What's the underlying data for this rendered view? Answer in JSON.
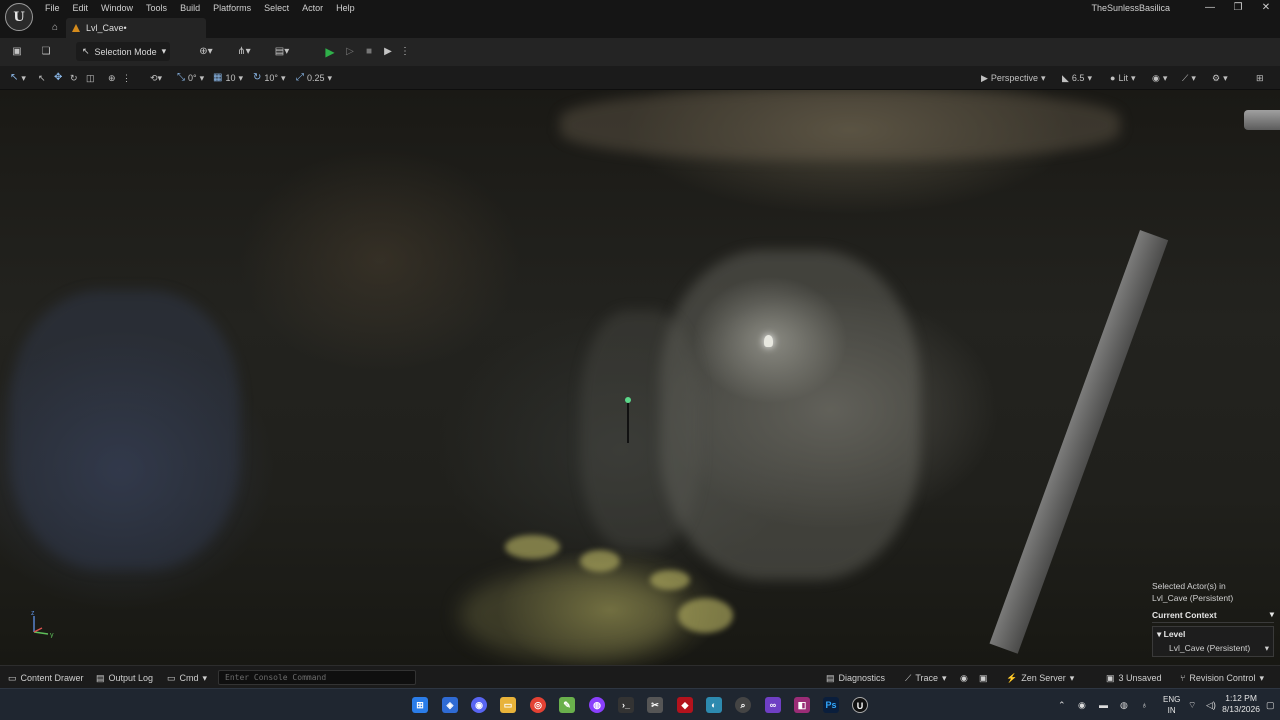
{
  "menubar": {
    "logo": "U",
    "items": [
      "File",
      "Edit",
      "Window",
      "Tools",
      "Build",
      "Platforms",
      "Select",
      "Actor",
      "Help"
    ],
    "project_name": "TheSunlessBasilica",
    "window_controls": {
      "minimize": "—",
      "restore": "❐",
      "close": "✕"
    }
  },
  "tabs": {
    "home_icon": "⌂",
    "level_tab": "Lvl_Cave•"
  },
  "toolbar": {
    "selection_mode": "Selection Mode"
  },
  "viewport_toolbar": {
    "grid_rotation": "0°",
    "grid_snap": "10",
    "rotation_snap": "10°",
    "scale_snap": "0.25",
    "view_mode": "Perspective",
    "camera_speed": "6.5",
    "lighting": "Lit"
  },
  "context": {
    "selected_line1": "Selected Actor(s) in",
    "selected_line2": "Lvl_Cave (Persistent)",
    "header": "Current Context",
    "level_title": "Level",
    "level_value": "Lvl_Cave (Persistent)"
  },
  "statusbar": {
    "content_drawer": "Content Drawer",
    "output_log": "Output Log",
    "cmd": "Cmd",
    "console_placeholder": "Enter Console Command",
    "diagnostics": "Diagnostics",
    "trace": "Trace",
    "zen_server": "Zen Server",
    "unsaved": "3 Unsaved",
    "revision_control": "Revision Control"
  },
  "taskbar": {
    "lang_line1": "ENG",
    "lang_line2": "IN",
    "time": "1:12 PM",
    "date": "8/13/2026",
    "ps_label": "Ps",
    "ue_label": "U"
  },
  "colors": {
    "accent_play": "#2fb04a",
    "panel_bg": "#242424",
    "menubar_bg": "#151515",
    "tab_icon": "#d58b1c"
  }
}
